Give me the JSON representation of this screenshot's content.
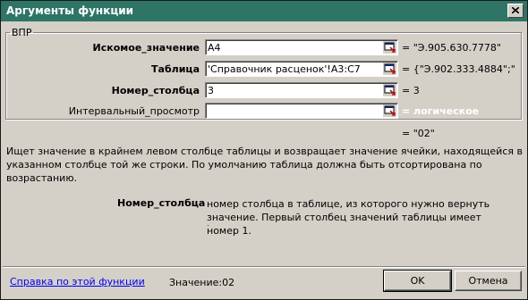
{
  "window": {
    "title": "Аргументы функции",
    "close_icon": "close-icon"
  },
  "group": {
    "legend": "ВПР"
  },
  "args": [
    {
      "label": "Искомое_значение",
      "bold": true,
      "value": "A4",
      "result": "= \"Э.905.630.7778\""
    },
    {
      "label": "Таблица",
      "bold": true,
      "value": "'Справочник расценок'!A3:C7",
      "result": "= {\"Э.902.333.4884\";\""
    },
    {
      "label": "Номер_столбца",
      "bold": true,
      "value": "3",
      "result": "= 3"
    },
    {
      "label": "Интервальный_просмотр",
      "bold": false,
      "value": "",
      "result": "= логическое"
    }
  ],
  "formula_result": "= \"02\"",
  "description": "Ищет значение в крайнем левом столбце таблицы и возвращает значение ячейки, находящейся в указанном столбце той же строки. По умолчанию таблица должна быть отсортирована по возрастанию.",
  "arg_help": {
    "name": "Номер_столбца",
    "text": "номер столбца в таблице, из которого нужно вернуть значение. Первый столбец значений таблицы имеет номер 1."
  },
  "footer": {
    "help_link": "Справка по этой функции",
    "value_label": "Значение:",
    "value": "02",
    "ok_label": "OK",
    "cancel_label": "Отмена"
  },
  "colors": {
    "titlebar": "#2e7566",
    "dialog_bg": "#d4d0c8",
    "link": "#0000ee"
  }
}
